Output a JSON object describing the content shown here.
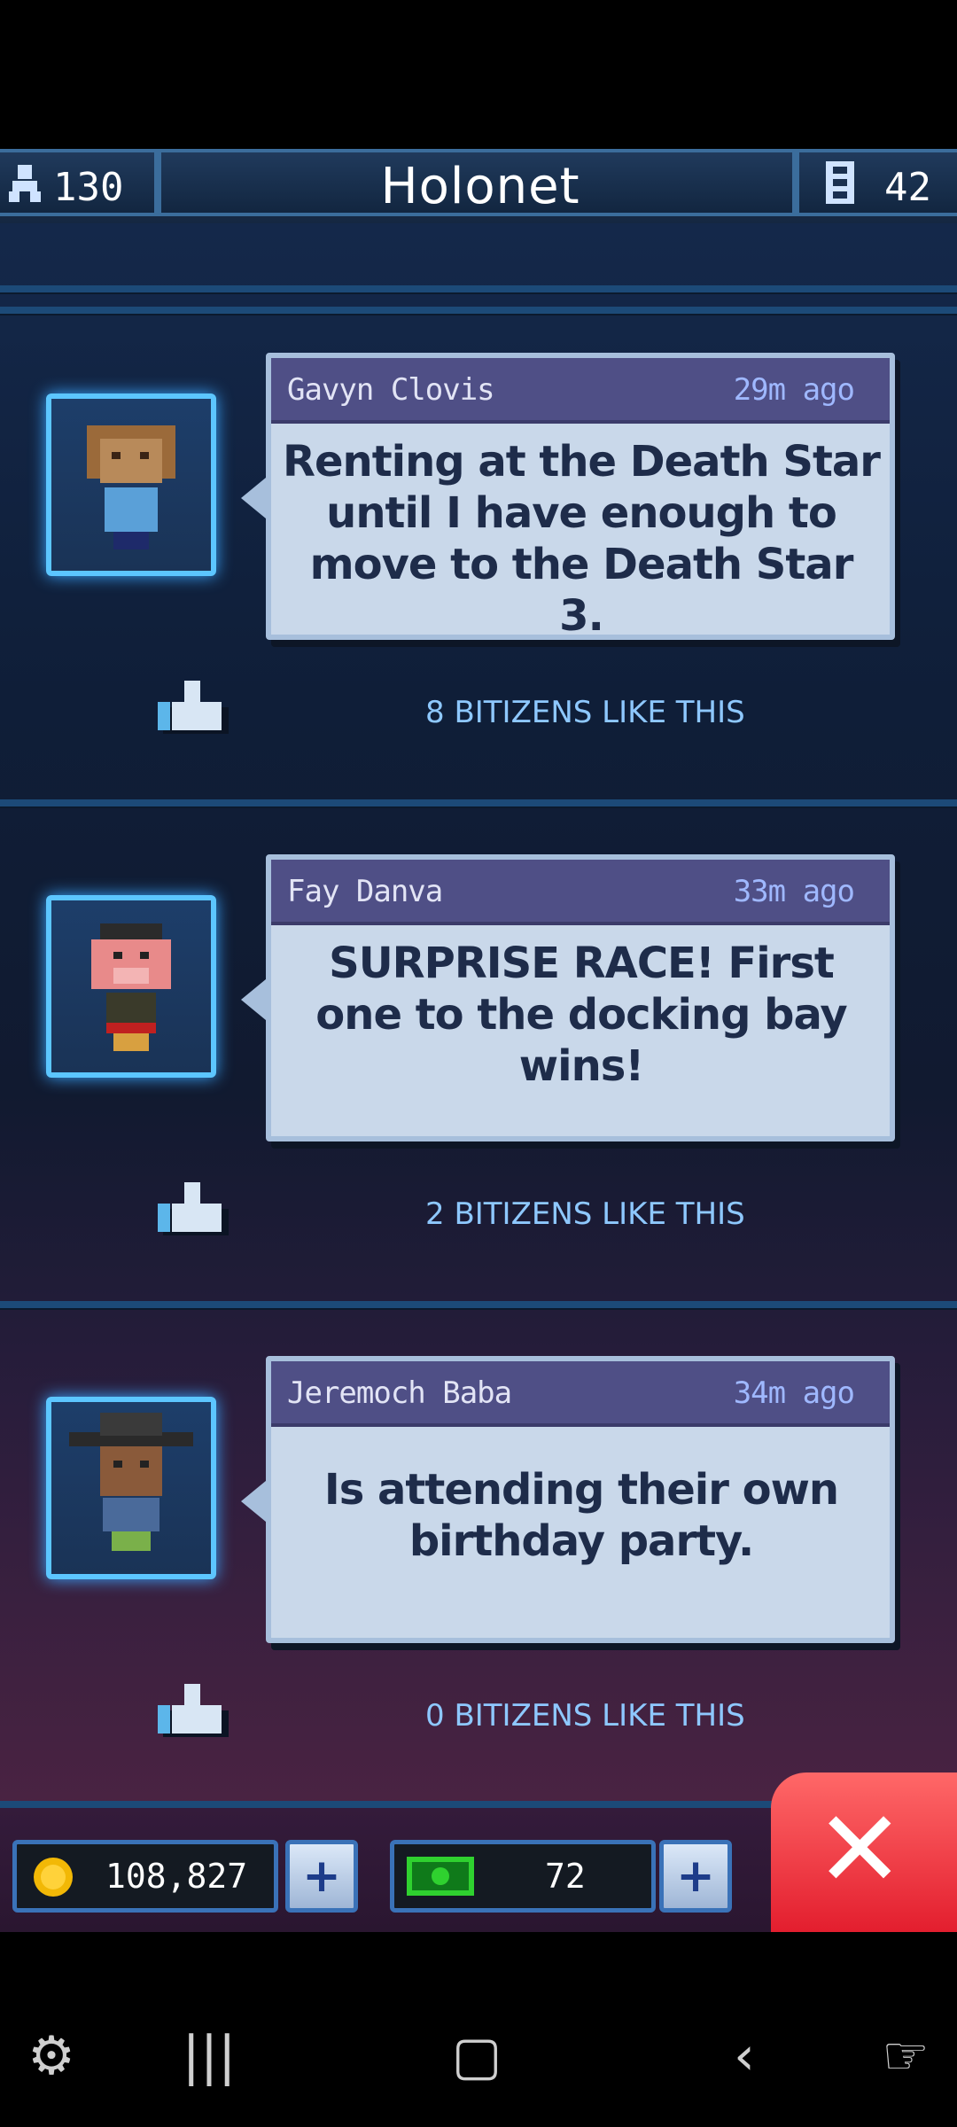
{
  "header": {
    "population": "130",
    "title": "Holonet",
    "floors": "42"
  },
  "posts": [
    {
      "author": "Gavyn Clovis",
      "time": "29m ago",
      "message": "Renting at the Death Star until I have enough to move to the Death Star 3.",
      "likes": "8 BITIZENS LIKE THIS"
    },
    {
      "author": "Fay Danva",
      "time": "33m ago",
      "message": "SURPRISE RACE! First one to the docking bay wins!",
      "likes": "2 BITIZENS LIKE THIS"
    },
    {
      "author": "Jeremoch Baba",
      "time": "34m ago",
      "message": "Is attending their own birthday party.",
      "likes": "0 BITIZENS LIKE THIS"
    }
  ],
  "resources": {
    "coins": "108,827",
    "bux": "72"
  },
  "colors": {
    "accent": "#5cc6ff",
    "like_text": "#8ec8ff",
    "close": "#e31e2e"
  },
  "icons": [
    "person-icon",
    "floor-icon",
    "thumbs-up-icon",
    "coin-icon",
    "bux-icon",
    "plus-icon",
    "close-icon",
    "game-launcher-icon",
    "recent-apps-icon",
    "home-icon",
    "back-icon",
    "assistant-icon"
  ]
}
